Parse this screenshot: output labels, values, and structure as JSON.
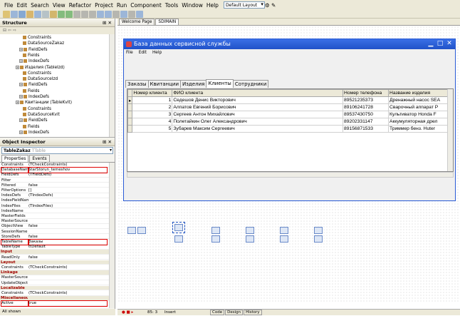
{
  "menu": [
    "File",
    "Edit",
    "Search",
    "View",
    "Refactor",
    "Project",
    "Run",
    "Component",
    "Tools",
    "Window",
    "Help"
  ],
  "layout_select": "Default Layout",
  "structure": {
    "title": "Structure",
    "items": [
      {
        "label": "Constraints",
        "indent": 2,
        "plus": false
      },
      {
        "label": "DataSourceZakaz",
        "indent": 2,
        "plus": false
      },
      {
        "label": "FieldDefs",
        "indent": 1,
        "plus": true
      },
      {
        "label": "Fields",
        "indent": 2,
        "plus": false
      },
      {
        "label": "IndexDefs",
        "indent": 1,
        "plus": true
      },
      {
        "label": "Изделия (TableIzd)",
        "indent": 0,
        "plus": true
      },
      {
        "label": "Constraints",
        "indent": 2,
        "plus": false
      },
      {
        "label": "DataSourceIzd",
        "indent": 2,
        "plus": false
      },
      {
        "label": "FieldDefs",
        "indent": 1,
        "plus": true
      },
      {
        "label": "Fields",
        "indent": 2,
        "plus": false
      },
      {
        "label": "IndexDefs",
        "indent": 1,
        "plus": true
      },
      {
        "label": "Квитанции (TableKvit)",
        "indent": 0,
        "plus": true
      },
      {
        "label": "Constraints",
        "indent": 2,
        "plus": false
      },
      {
        "label": "DataSourceKvit",
        "indent": 2,
        "plus": false
      },
      {
        "label": "FieldDefs",
        "indent": 1,
        "plus": true
      },
      {
        "label": "Fields",
        "indent": 2,
        "plus": false
      },
      {
        "label": "IndexDefs",
        "indent": 1,
        "plus": true
      }
    ]
  },
  "object_inspector": {
    "title": "Object Inspector",
    "component": "TableZakaz",
    "component_type": "TTable",
    "tabs": [
      "Properties",
      "Events"
    ],
    "properties": [
      {
        "name": "Constraints",
        "value": "(TCheckConstraints)",
        "cat": false,
        "hl": false
      },
      {
        "name": "DatabaseName",
        "value": "StarStorun_temeshov",
        "cat": false,
        "hl": true
      },
      {
        "name": "FieldDefs",
        "value": "(TFieldDefs)",
        "cat": false,
        "hl": false
      },
      {
        "name": "Filter",
        "value": "",
        "cat": false,
        "hl": false
      },
      {
        "name": "Filtered",
        "value": "false",
        "cat": false,
        "hl": false
      },
      {
        "name": "FilterOptions",
        "value": "[]",
        "cat": false,
        "hl": false
      },
      {
        "name": "IndexDefs",
        "value": "(TIndexDefs)",
        "cat": false,
        "hl": false
      },
      {
        "name": "IndexFieldNam",
        "value": "",
        "cat": false,
        "hl": false
      },
      {
        "name": "IndexFiles",
        "value": "(TIndexFiles)",
        "cat": false,
        "hl": false
      },
      {
        "name": "IndexName",
        "value": "",
        "cat": false,
        "hl": false
      },
      {
        "name": "MasterFields",
        "value": "",
        "cat": false,
        "hl": false
      },
      {
        "name": "MasterSource",
        "value": "",
        "cat": false,
        "hl": false
      },
      {
        "name": "ObjectView",
        "value": "false",
        "cat": false,
        "hl": false
      },
      {
        "name": "SessionName",
        "value": "",
        "cat": false,
        "hl": false
      },
      {
        "name": "StoreDefs",
        "value": "false",
        "cat": false,
        "hl": false
      },
      {
        "name": "TableName",
        "value": "Заказы",
        "cat": false,
        "hl": true
      },
      {
        "name": "TableType",
        "value": "ttDefault",
        "cat": false,
        "hl": false
      },
      {
        "name": "Input",
        "value": "",
        "cat": true,
        "hl": false
      },
      {
        "name": "ReadOnly",
        "value": "false",
        "cat": false,
        "hl": false
      },
      {
        "name": "Layout",
        "value": "",
        "cat": true,
        "hl": false
      },
      {
        "name": "Constraints",
        "value": "(TCheckConstraints)",
        "cat": false,
        "hl": false
      },
      {
        "name": "Linkage",
        "value": "",
        "cat": true,
        "hl": false
      },
      {
        "name": "MasterSource",
        "value": "",
        "cat": false,
        "hl": false
      },
      {
        "name": "UpdateObject",
        "value": "",
        "cat": false,
        "hl": false
      },
      {
        "name": "Localizable",
        "value": "",
        "cat": true,
        "hl": false
      },
      {
        "name": "Constraints",
        "value": "(TCheckConstraints)",
        "cat": false,
        "hl": false
      },
      {
        "name": "Miscellaneous",
        "value": "",
        "cat": true,
        "hl": false
      },
      {
        "name": "Active",
        "value": "true",
        "cat": false,
        "hl": true
      }
    ],
    "status": "All shown"
  },
  "doc_tabs": [
    "Welcome Page",
    "SDIMAIN"
  ],
  "form": {
    "title": "База данных сервисной службы",
    "menu": [
      "File",
      "Edit",
      "Help"
    ],
    "tabs": [
      "Заказы",
      "Квитанции",
      "Изделия",
      "Клиенты",
      "Сотрудники"
    ],
    "active_tab": 3,
    "columns": [
      "Номер клиента",
      "ФИО клиента",
      "Номер телефона",
      "Название изделия"
    ],
    "rows": [
      [
        "1",
        "Седешов Денис Викторович",
        "89521235373",
        "Дренажный насос SEA"
      ],
      [
        "2",
        "Алпатов Евгений Борисович",
        "89106241728",
        "Сварочный аппарат Р"
      ],
      [
        "3",
        "Сергеев Антон Михайлович",
        "89537430750",
        "Культиватор Honda F"
      ],
      [
        "4",
        "Полетайкин Олег Александрович",
        "89202331147",
        "Аккумуляторная дрел"
      ],
      [
        "5",
        "Зубарев Максим Сергеевич",
        "89156871533",
        "Триммер бенз. Huter"
      ]
    ]
  },
  "statusbar": {
    "position": "85: 3",
    "mode": "Insert",
    "tabs": [
      "Code",
      "Design",
      "History"
    ]
  }
}
